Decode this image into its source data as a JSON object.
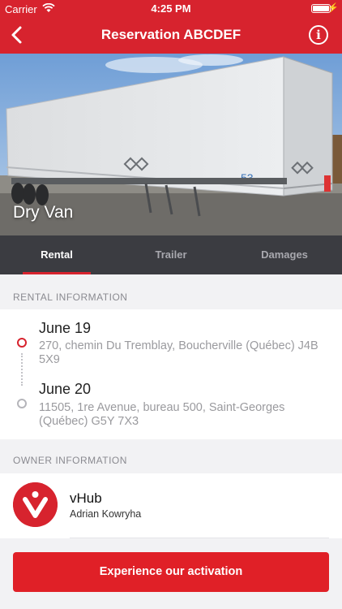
{
  "status_bar": {
    "carrier": "Carrier",
    "time": "4:25 PM"
  },
  "nav": {
    "title": "Reservation ABCDEF",
    "back_icon": "chevron-left-icon",
    "info_icon": "info-icon",
    "info_glyph": "i"
  },
  "hero": {
    "label": "Dry Van",
    "trailer_number": "53"
  },
  "tabs": [
    {
      "label": "Rental",
      "active": true
    },
    {
      "label": "Trailer",
      "active": false
    },
    {
      "label": "Damages",
      "active": false
    }
  ],
  "rental_info": {
    "heading": "RENTAL INFORMATION",
    "start": {
      "date": "June 19",
      "address": "270, chemin Du Tremblay, Boucherville (Québec) J4B 5X9"
    },
    "end": {
      "date": "June 20",
      "address": "11505, 1re Avenue, bureau 500, Saint-Georges (Québec) G5Y 7X3"
    }
  },
  "owner_info": {
    "heading": "OWNER INFORMATION",
    "name": "vHub",
    "contact": "Adrian Kowryha"
  },
  "cta": {
    "label": "Experience our activation"
  },
  "colors": {
    "brand": "#d7232e",
    "tabbar": "#3b3c41",
    "muted": "#8a8a90"
  }
}
